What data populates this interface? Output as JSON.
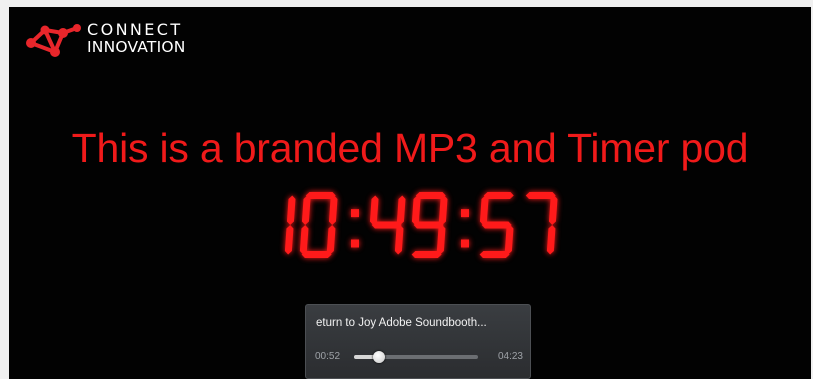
{
  "logo": {
    "line1": "CONNECT",
    "line2": "INNOVATION",
    "icon": "molecule-logo-icon",
    "color": "#e8262b"
  },
  "headline": "This is a branded MP3 and Timer pod",
  "timer": {
    "display": "10:49:57",
    "color": "#ff1a1a"
  },
  "player": {
    "track_title": "eturn to Joy Adobe Soundbooth...",
    "elapsed": "00:52",
    "total": "04:23",
    "progress": 0.205
  }
}
